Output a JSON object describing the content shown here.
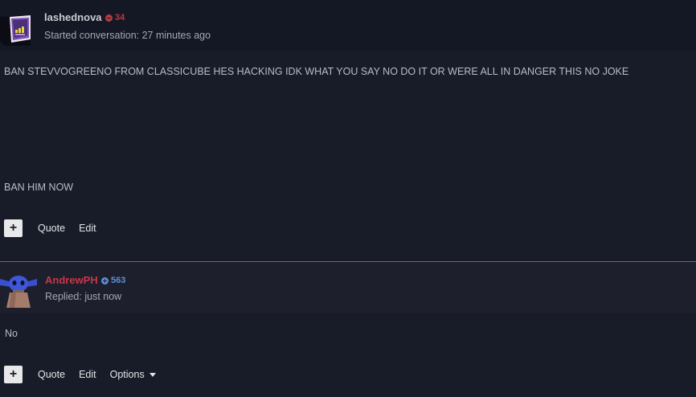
{
  "posts": [
    {
      "username": "lashednova",
      "reputation": "34",
      "reputation_sign": "negative",
      "meta": "Started conversation: 27 minutes ago",
      "body": [
        "BAN STEVVOGREENO FROM CLASSICUBE HES HACKING IDK WHAT YOU SAY NO DO IT OR WERE ALL IN DANGER THIS NO JOKE",
        "BAN HIM NOW"
      ],
      "actions": {
        "plus": "+",
        "quote": "Quote",
        "edit": "Edit"
      }
    },
    {
      "username": "AndrewPH",
      "reputation": "563",
      "reputation_sign": "positive",
      "meta": "Replied: just now",
      "body": [
        "No"
      ],
      "actions": {
        "plus": "+",
        "quote": "Quote",
        "edit": "Edit",
        "options": "Options"
      }
    }
  ],
  "colors": {
    "background": "#181c28",
    "divider": "#7a5a92",
    "staff_username": "#c7364a",
    "rep_negative": "#b83a40",
    "rep_positive": "#5c8fd6"
  }
}
